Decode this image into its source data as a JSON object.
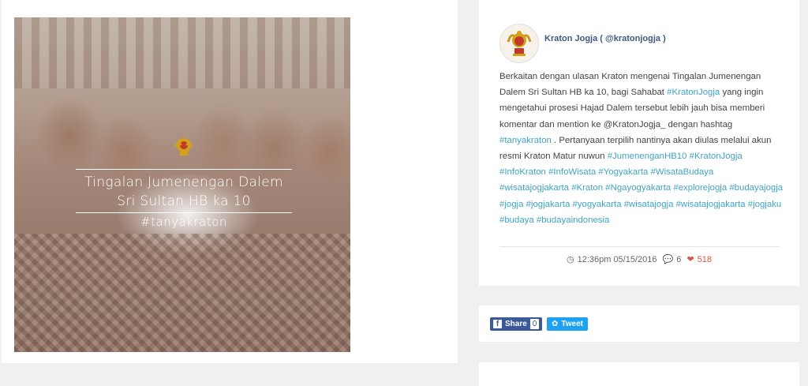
{
  "post_image": {
    "overlay_title_line1": "Tingalan Jumenengan Dalem",
    "overlay_title_line2": "Sri Sultan HB ka 10",
    "overlay_hashtag": "#tanyakraton"
  },
  "profile": {
    "username": "Kraton Jogja ( @kratonjogja )",
    "avatar_icon": "kraton-crest-icon"
  },
  "caption": {
    "p1": "Berkaitan dengan ulasan Kraton mengenai Tingalan Jumenengan Dalem Sri Sultan HB ka 10, bagi Sahabat",
    "p1_tag": "#KratonJogja",
    "p2": "yang ingin mengetahui prosesi Hajad Dalem tersebut lebih jauh bisa memberi komentar dan mention ke @KratonJogja_ dengan hashtag",
    "p2_tag": "#tanyakraton",
    "p3": ". Pertanyaan terpilih nantinya akan diulas melalui akun resmi Kraton Matur nuwun",
    "tags": [
      "#JumenenganHB10",
      "#KratonJogja",
      "#InfoKraton",
      "#InfoWisata",
      "#Yogyakarta",
      "#WisataBudaya",
      "#wisatajogjakarta",
      "#Kraton",
      "#Ngayogyakarta",
      "#explorejogja",
      "#budayajogja",
      "#jogja",
      "#jogjakarta",
      "#yogyakarta",
      "#wisatajogja",
      "#wisatajogjakarta",
      "#jogjaku",
      "#budaya",
      "#budayaindonesia"
    ]
  },
  "meta": {
    "time": "12:36pm 05/15/2016",
    "comments": "6",
    "likes": "518",
    "time_icon": "clock-icon",
    "comments_icon": "comments-icon",
    "likes_icon": "heart-icon"
  },
  "share": {
    "facebook_label": "Share",
    "facebook_count": "0",
    "twitter_label": "Tweet"
  },
  "colors": {
    "accent": "#3fa3c5",
    "username": "#3d5a80",
    "like": "#d9534f",
    "facebook": "#3b5998",
    "twitter": "#1da1f2"
  }
}
